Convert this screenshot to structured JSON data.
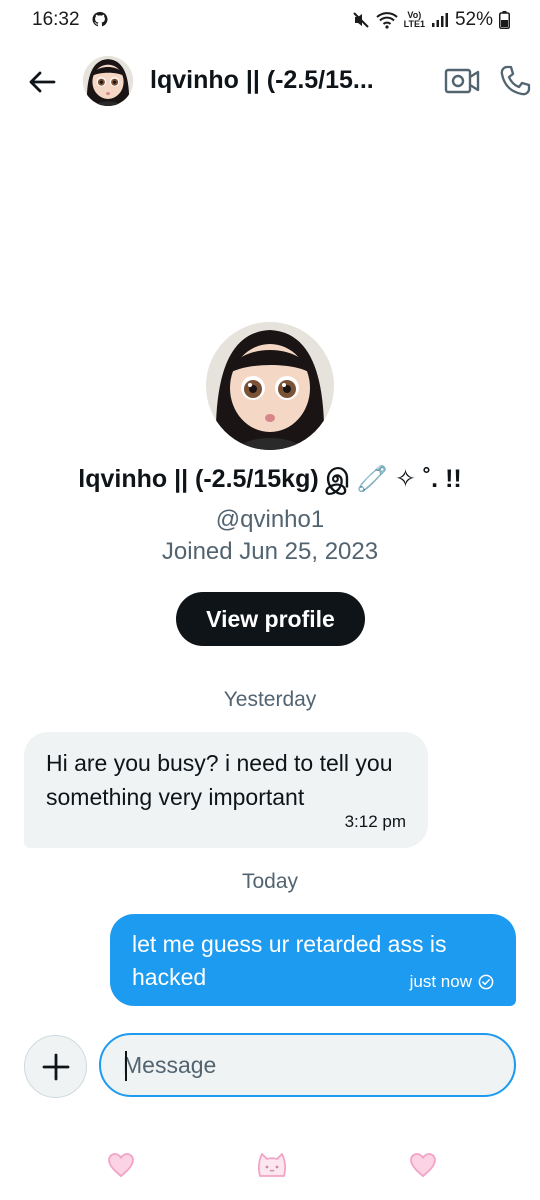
{
  "status_bar": {
    "time": "16:32",
    "network_top": "Vo)",
    "network_bottom": "LTE1",
    "battery": "52%"
  },
  "header": {
    "title": "lqvinho || (-2.5/15..."
  },
  "profile": {
    "name": "lqvinho || (-2.5/15kg) இ 🧷 ✧ ˚. !!",
    "handle": "@qvinho1",
    "joined": "Joined Jun 25, 2023",
    "view_profile_label": "View profile"
  },
  "conversation": {
    "day_yesterday": "Yesterday",
    "day_today": "Today",
    "messages": [
      {
        "direction": "incoming",
        "text": "Hi  are you busy? i need to tell you something very important",
        "time": "3:12 pm"
      },
      {
        "direction": "outgoing",
        "text": "let me guess ur retarded ass is hacked",
        "time": "just now"
      }
    ]
  },
  "composer": {
    "placeholder": "Message"
  },
  "colors": {
    "accent": "#1d9bf0",
    "bubble_incoming": "#eff3f4",
    "text_primary": "#0f1419",
    "text_secondary": "#536471",
    "nav_heart": "#f7b6d2"
  },
  "icons": {
    "back": "arrow-left-icon",
    "video": "video-camera-icon",
    "call": "phone-icon",
    "add": "plus-icon",
    "sent": "check-circle-icon",
    "nav": [
      "heart-icon",
      "cat-face-icon",
      "heart-icon"
    ]
  }
}
